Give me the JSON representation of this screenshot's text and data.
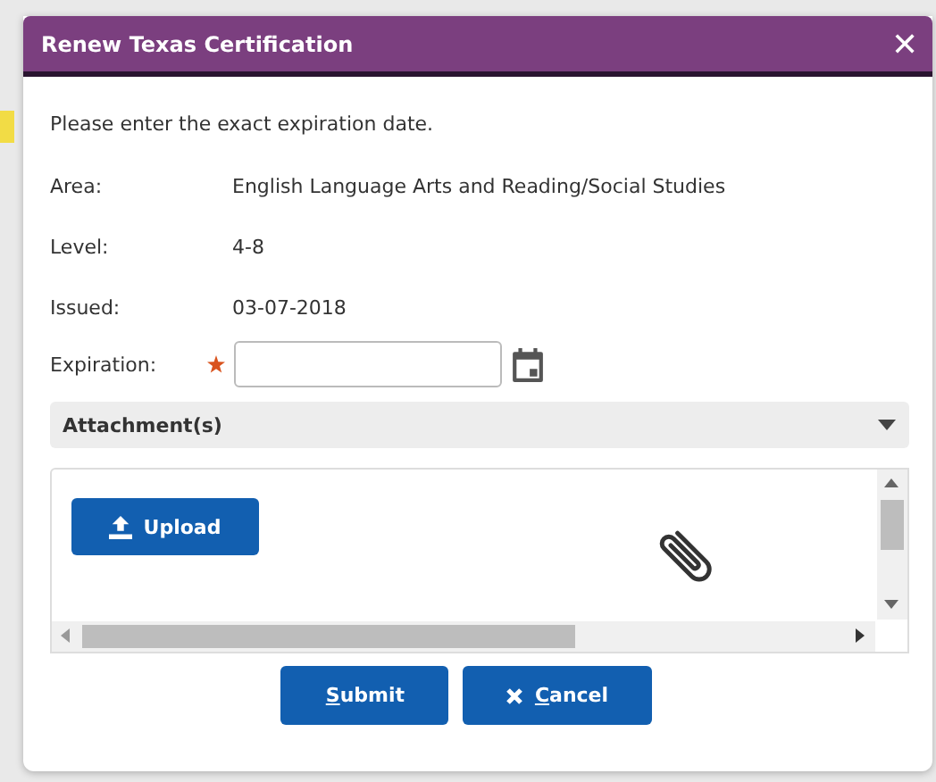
{
  "dialog": {
    "title": "Renew Texas Certification",
    "close": "✕"
  },
  "intro": "Please enter the exact expiration date.",
  "fields": [
    {
      "label": "Area:",
      "value": "English Language Arts and Reading/Social Studies"
    },
    {
      "label": "Level:",
      "value": "4-8"
    },
    {
      "label": "Issued:",
      "value": "03-07-2018"
    }
  ],
  "expiration": {
    "label": "Expiration:",
    "required": true
  },
  "attachments": {
    "title": "Attachment(s)",
    "expanded": true,
    "upload": "Upload"
  },
  "buttons": [
    {
      "kind": "submit",
      "label": "Submit"
    },
    {
      "kind": "cancel",
      "label": "Cancel"
    }
  ]
}
